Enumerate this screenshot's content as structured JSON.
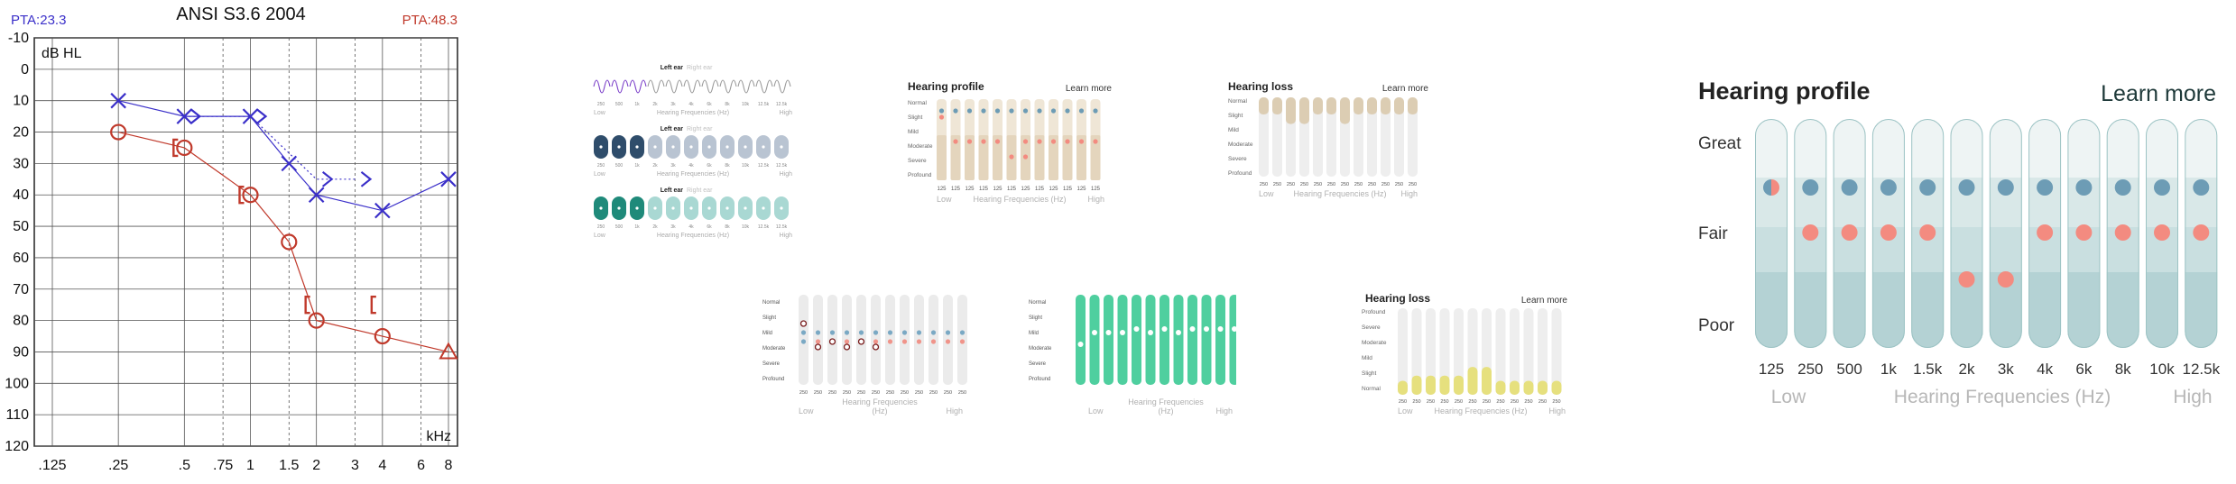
{
  "audiogram": {
    "title": "ANSI S3.6 2004",
    "pta_left": "PTA:23.3",
    "pta_right": "PTA:48.3",
    "y_unit": "dB HL",
    "x_unit": "kHz",
    "y_ticks": [
      "-10",
      "0",
      "10",
      "20",
      "30",
      "40",
      "50",
      "60",
      "70",
      "80",
      "90",
      "100",
      "110",
      "120"
    ],
    "x_ticks": [
      ".125",
      ".25",
      ".5",
      ".75",
      "1",
      "1.5",
      "2",
      "3",
      "4",
      "6",
      "8"
    ],
    "colors": {
      "left": "#3a2fc9",
      "right": "#c0392b"
    }
  },
  "chart_data": {
    "type": "scatter",
    "title": "ANSI S3.6 2004",
    "xlabel": "kHz",
    "ylabel": "dB HL",
    "x_scale": "log",
    "ylim": [
      -10,
      120
    ],
    "y_inverted": true,
    "series": [
      {
        "x": [
          0.25,
          0.5,
          1,
          1.5,
          2,
          4,
          8
        ],
        "y": [
          10,
          15,
          15,
          30,
          40,
          45,
          35
        ]
      },
      {
        "x": [
          0.25,
          0.5,
          1,
          1.5,
          2,
          4,
          8
        ],
        "y": [
          20,
          25,
          40,
          55,
          80,
          85,
          90
        ]
      },
      {
        "x": [
          0.5,
          1,
          2,
          3
        ],
        "y": [
          15,
          15,
          35,
          35
        ]
      },
      {
        "x": [
          0.5,
          1,
          2,
          4
        ],
        "y": [
          25,
          40,
          75,
          75
        ]
      }
    ]
  },
  "thumb1": {
    "rows": [
      {
        "title": "Left ear",
        "alt": "Right ear"
      },
      {
        "title": "Left ear",
        "alt": "Right ear"
      },
      {
        "title": "Left ear",
        "alt": "Right ear"
      }
    ],
    "freqs": [
      "250",
      "500",
      "1k",
      "2k",
      "3k",
      "4k",
      "6k",
      "8k",
      "10k",
      "12.5k",
      "12.5k"
    ],
    "low": "Low",
    "high": "High",
    "axis": "Hearing Frequencies (Hz)"
  },
  "thumb2": {
    "title": "Hearing profile",
    "link": "Learn more",
    "levels": [
      "Normal",
      "Slight",
      "Mild",
      "Moderate",
      "Severe",
      "Profound"
    ],
    "freqs": [
      "125",
      "125",
      "125",
      "125",
      "125",
      "125",
      "125",
      "125",
      "125",
      "125",
      "125",
      "125"
    ],
    "low": "Low",
    "high": "High",
    "axis": "Hearing Frequencies (Hz)"
  },
  "thumb3": {
    "title": "Hearing loss",
    "link": "Learn more",
    "levels": [
      "Normal",
      "Slight",
      "Mild",
      "Moderate",
      "Severe",
      "Profound"
    ],
    "freqs": [
      "250",
      "250",
      "250",
      "250",
      "250",
      "250",
      "250",
      "250",
      "250",
      "250",
      "250",
      "250"
    ],
    "fill": [
      0.92,
      0.92,
      0.8,
      0.8,
      0.92,
      0.92,
      0.8,
      0.92,
      0.92,
      0.92,
      0.92,
      0.92
    ],
    "low": "Low",
    "high": "High",
    "axis": "Hearing Frequencies (Hz)"
  },
  "thumb4": {
    "levels": [
      "Normal",
      "Slight",
      "Mild",
      "Moderate",
      "Severe",
      "Profound"
    ],
    "freqs": [
      "250",
      "250",
      "250",
      "250",
      "250",
      "250",
      "250",
      "250",
      "250",
      "250",
      "250",
      "250"
    ],
    "low": "Low",
    "high": "High",
    "axis1": "Hearing Frequencies",
    "axis2": "(Hz)"
  },
  "thumb5": {
    "levels": [
      "Normal",
      "Slight",
      "Mild",
      "Moderate",
      "Severe",
      "Profound"
    ],
    "low": "Low",
    "high": "High",
    "axis1": "Hearing Frequencies",
    "axis2": "(Hz)"
  },
  "thumb6": {
    "title": "Hearing loss",
    "link": "Learn more",
    "levels": [
      "Profound",
      "Severe",
      "Moderate",
      "Mild",
      "Slight",
      "Normal"
    ],
    "freqs": [
      "250",
      "250",
      "250",
      "250",
      "250",
      "250",
      "250",
      "250",
      "250",
      "250",
      "250",
      "250"
    ],
    "fill": [
      0.12,
      0.18,
      0.18,
      0.18,
      0.18,
      0.28,
      0.28,
      0.12,
      0.12,
      0.12,
      0.12,
      0.12
    ],
    "low": "Low",
    "high": "High",
    "axis": "Hearing Frequencies (Hz)"
  },
  "hearing_profile": {
    "title": "Hearing profile",
    "link": "Learn more",
    "levels": [
      "Great",
      "Fair",
      "Poor"
    ],
    "freqs": [
      "125",
      "250",
      "500",
      "1k",
      "1.5k",
      "2k",
      "3k",
      "4k",
      "6k",
      "8k",
      "10k",
      "12.5k"
    ],
    "blue_row": [
      1,
      1,
      1,
      1,
      1,
      1,
      1,
      1,
      1,
      1,
      1,
      1
    ],
    "red_row": [
      0,
      1,
      1,
      1,
      1,
      0,
      0,
      1,
      1,
      1,
      1,
      1
    ],
    "red_low": [
      0,
      0,
      0,
      0,
      0,
      1,
      1,
      0,
      0,
      0,
      0,
      0
    ],
    "low": "Low",
    "high": "High",
    "axis": "Hearing Frequencies (Hz)",
    "colors": {
      "blue": "#6d9cb5",
      "red": "#f38b80",
      "track": "#d5e4e4"
    }
  }
}
